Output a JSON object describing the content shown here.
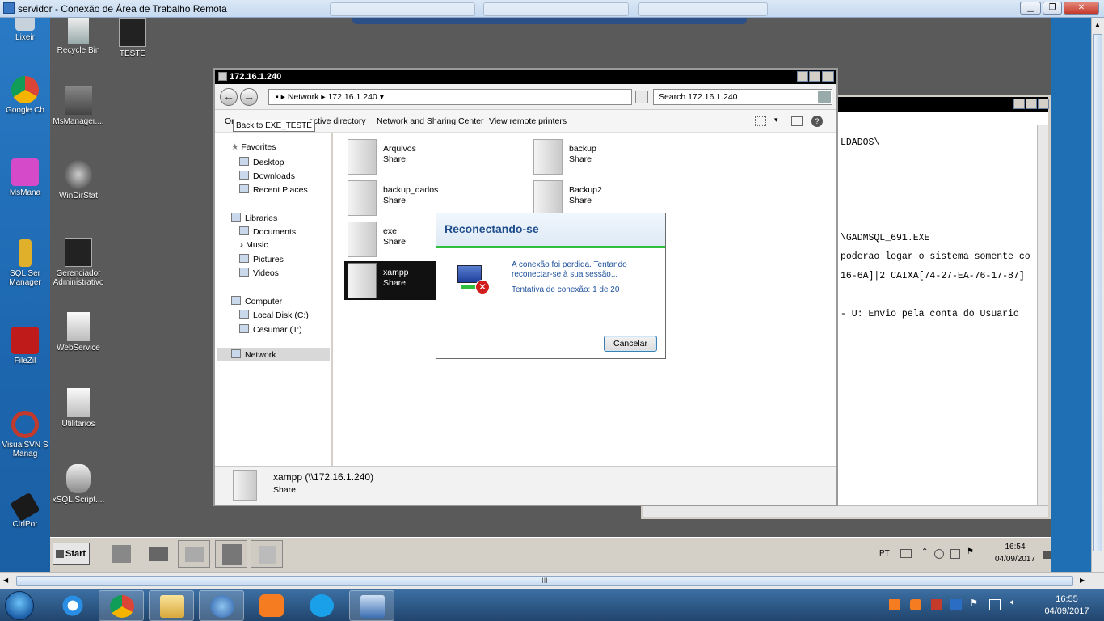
{
  "rdp_window": {
    "title": "servidor - Conexão de Área de Trabalho Remota",
    "minimize_glyph": "▁",
    "restore_glyph": "❐",
    "close_glyph": "✕"
  },
  "host_desktop_icons": [
    {
      "label": "Lixeir",
      "icon": "recycle-bin-icon"
    },
    {
      "label": "Google Ch",
      "icon": "chrome-icon"
    },
    {
      "label": "MsMana",
      "icon": "msmanager-icon"
    },
    {
      "label": "SQL Ser\nManager",
      "icon": "sql-server-icon"
    },
    {
      "label": "FileZil",
      "icon": "filezilla-icon"
    },
    {
      "label": "VisualSVN S\nManag",
      "icon": "visualsvn-icon"
    },
    {
      "label": "CtrlPor",
      "icon": "ctrlport-icon"
    }
  ],
  "remote_desktop_icons": [
    {
      "label": "Recycle Bin"
    },
    {
      "label": "TESTE"
    },
    {
      "label": "MsManager...."
    },
    {
      "label": "WinDirStat"
    },
    {
      "label": "Gerenciador Administrativo"
    },
    {
      "label": "WebService"
    },
    {
      "label": "Utilitarios"
    },
    {
      "label": "xSQL.Script...."
    }
  ],
  "console": {
    "lines": [
      "LDADOS\\",
      "\\GADMSQL_691.EXE",
      "poderao logar o sistema somente co",
      "16-6A]|2 CAIXA[74-27-EA-76-17-87]",
      "- U: Envio pela conta do Usuario"
    ]
  },
  "explorer": {
    "title": "172.16.1.240",
    "breadcrumb": {
      "root": "Network",
      "host": "172.16.1.240"
    },
    "search_placeholder": "Search 172.16.1.240",
    "commands": {
      "organize_prefix": "Or",
      "active_directory": "active directory",
      "network_sharing": "Network and Sharing Center",
      "remote_printers": "View remote printers"
    },
    "tooltip": "Back to EXE_TESTE",
    "nav": {
      "favorites": "Favorites",
      "desktop": "Desktop",
      "downloads": "Downloads",
      "recent": "Recent Places",
      "libraries": "Libraries",
      "documents": "Documents",
      "music": "Music",
      "pictures": "Pictures",
      "videos": "Videos",
      "computer": "Computer",
      "local_disk": "Local Disk (C:)",
      "cesumar": "Cesumar (T:)",
      "network": "Network"
    },
    "shares": [
      {
        "name": "Arquivos",
        "kind": "Share"
      },
      {
        "name": "backup",
        "kind": "Share"
      },
      {
        "name": "backup_dados",
        "kind": "Share"
      },
      {
        "name": "Backup2",
        "kind": "Share"
      },
      {
        "name": "exe",
        "kind": "Share"
      },
      {
        "name": "xampp",
        "kind": "Share"
      }
    ],
    "details": {
      "name": "xampp (\\\\172.16.1.240)",
      "kind": "Share"
    }
  },
  "dialog": {
    "title": "Reconectando-se",
    "message": "A conexão foi perdida. Tentando reconectar-se à sua sessão...",
    "attempt": "Tentativa de conexão: 1 de 20",
    "cancel": "Cancelar"
  },
  "remote_taskbar": {
    "start": "Start",
    "lang": "PT",
    "time": "16:54",
    "date": "04/09/2017"
  },
  "host_taskbar": {
    "time": "16:55",
    "date": "04/09/2017"
  },
  "rdp_scroll": {
    "thumb_grip": "III"
  },
  "colors": {
    "accent_green": "#2fbf3f",
    "dialog_title": "#1f4e8c",
    "selection": "#111111"
  }
}
